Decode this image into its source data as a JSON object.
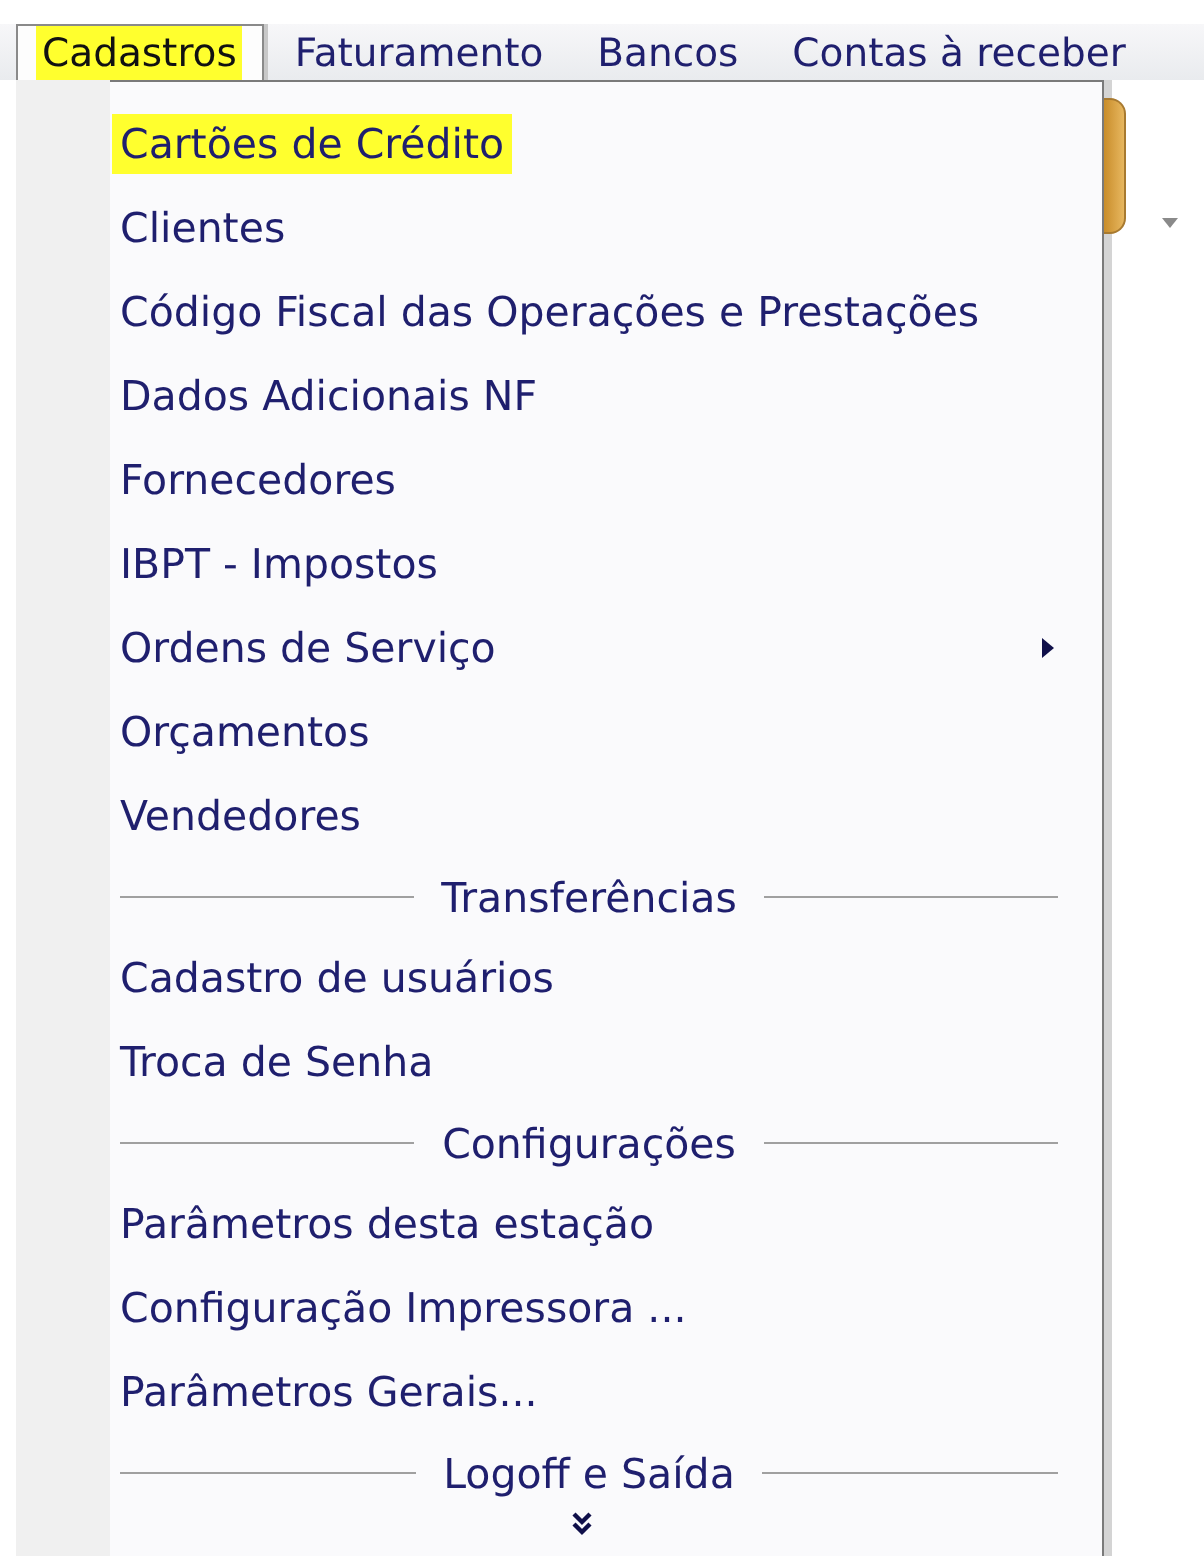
{
  "menu_bar": [
    {
      "label": "Cadastros",
      "selected": true,
      "highlighted": true
    },
    {
      "label": "Faturamento",
      "selected": false,
      "highlighted": false
    },
    {
      "label": "Bancos",
      "selected": false,
      "highlighted": false
    },
    {
      "label": "Contas à receber",
      "selected": false,
      "highlighted": false
    }
  ],
  "menu": [
    {
      "kind": "item",
      "label": "Cartões de Crédito",
      "highlighted": true
    },
    {
      "kind": "item",
      "label": "Clientes",
      "highlighted": false
    },
    {
      "kind": "item",
      "label": "Código Fiscal das Operações e Prestações",
      "highlighted": false
    },
    {
      "kind": "item",
      "label": "Dados Adicionais NF",
      "highlighted": false
    },
    {
      "kind": "item",
      "label": "Fornecedores",
      "highlighted": false
    },
    {
      "kind": "item",
      "label": "IBPT - Impostos",
      "highlighted": false
    },
    {
      "kind": "submenu",
      "label": "Ordens de Serviço",
      "highlighted": false
    },
    {
      "kind": "item",
      "label": "Orçamentos",
      "highlighted": false
    },
    {
      "kind": "item",
      "label": "Vendedores",
      "highlighted": false
    },
    {
      "kind": "separator",
      "label": "Transferências"
    },
    {
      "kind": "item",
      "label": "Cadastro de usuários",
      "highlighted": false
    },
    {
      "kind": "item",
      "label": "Troca de Senha",
      "highlighted": false
    },
    {
      "kind": "separator",
      "label": "Configurações"
    },
    {
      "kind": "item",
      "label": "Parâmetros desta estação",
      "highlighted": false
    },
    {
      "kind": "item",
      "label": "Configuração Impressora ...",
      "highlighted": false
    },
    {
      "kind": "item",
      "label": "Parâmetros Gerais...",
      "highlighted": false
    },
    {
      "kind": "separator",
      "label": "Logoff e Saída"
    },
    {
      "kind": "more"
    }
  ]
}
